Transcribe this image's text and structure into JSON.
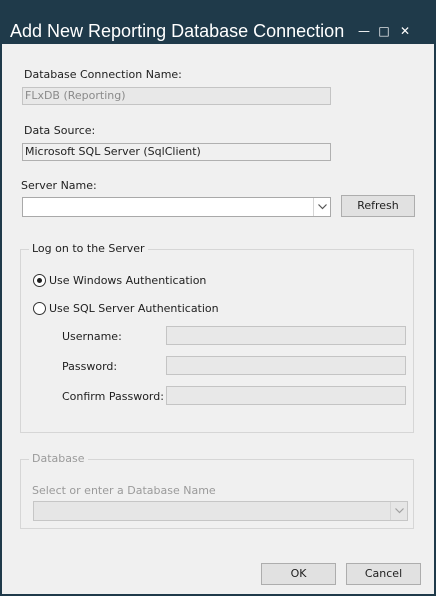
{
  "window": {
    "title": "Add New Reporting Database Connection",
    "minimize_icon": "minimize-icon",
    "maximize_icon": "maximize-icon",
    "close_icon": "close-icon",
    "minimize_glyph": "—",
    "maximize_glyph": "□",
    "close_glyph": "✕"
  },
  "form": {
    "connection_name_label": "Database Connection Name:",
    "connection_name_value": "FLxDB (Reporting)",
    "data_source_label": "Data Source:",
    "data_source_value": "Microsoft SQL Server (SqlClient)",
    "server_name_label": "Server Name:",
    "server_name_value": "",
    "refresh_label": "Refresh"
  },
  "logon": {
    "legend": "Log on to the Server",
    "windows_auth_label": "Use Windows Authentication",
    "windows_auth_selected": true,
    "sql_auth_label": "Use SQL Server Authentication",
    "sql_auth_selected": false,
    "username_label": "Username:",
    "password_label": "Password:",
    "confirm_password_label": "Confirm Password:"
  },
  "database": {
    "legend": "Database",
    "select_label": "Select or enter a Database Name",
    "select_value": ""
  },
  "footer": {
    "ok_label": "OK",
    "cancel_label": "Cancel"
  },
  "colors": {
    "titlebar": "#1f3a4a",
    "client": "#f0f0f0"
  }
}
